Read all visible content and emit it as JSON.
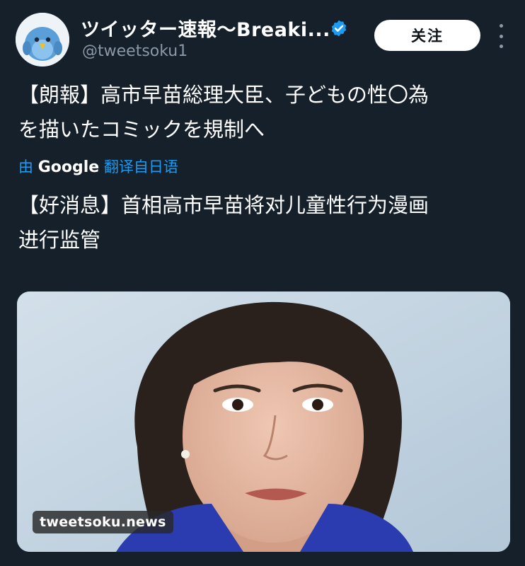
{
  "author": {
    "display_name": "ツイッター速報〜Breaki...",
    "handle": "@tweetsoku1",
    "avatar_icon": "bird-icon",
    "verified_icon": "verified-badge-icon"
  },
  "actions": {
    "follow_label": "关注",
    "more_icon": "more-vertical-icon"
  },
  "tweet": {
    "text": "【朗報】高市早苗総理大臣、子どもの性〇為\nを描いたコミックを規制へ",
    "translation_prefix": "由",
    "translation_provider": "Google",
    "translation_action": "翻译自日语",
    "translated_text": "【好消息】首相高市早苗将对儿童性行为漫画\n进行监管"
  },
  "media": {
    "watermark": "tweetsoku.news"
  },
  "colors": {
    "background": "#15202b",
    "link": "#1d9bf0",
    "muted": "#8b98a5",
    "verified": "#1d9bf0"
  }
}
